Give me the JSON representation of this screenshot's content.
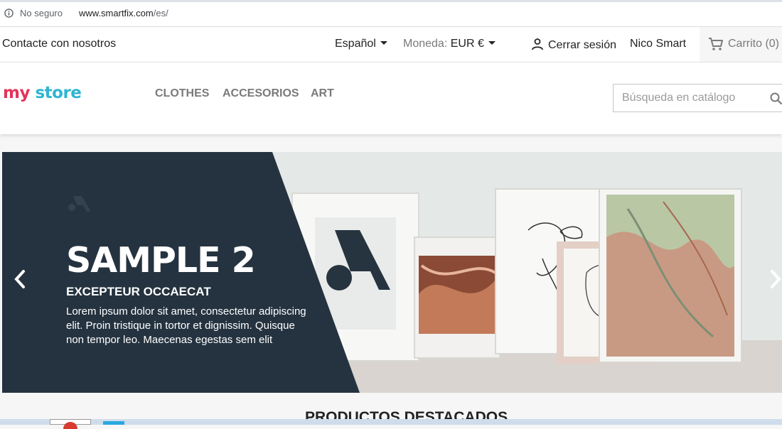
{
  "browser": {
    "security_label": "No seguro",
    "url_host": "www.smartfix.com",
    "url_path": "/es/"
  },
  "topnav": {
    "contact": "Contacte con nosotros",
    "language": "Español",
    "currency_label": "Moneda:",
    "currency_value": "EUR €",
    "logout": "Cerrar sesión",
    "user": "Nico Smart",
    "cart": "Carrito (0)"
  },
  "header": {
    "logo": {
      "part1": "my",
      "part2": " store"
    },
    "menu": [
      "CLOTHES",
      "ACCESORIOS",
      "ART"
    ],
    "search_placeholder": "Búsqueda en catálogo"
  },
  "slide": {
    "title": "SAMPLE 2",
    "subtitle": "EXCEPTEUR OCCAECAT",
    "text": "Lorem ipsum dolor sit amet, consectetur adipiscing elit. Proin tristique in tortor et dignissim. Quisque non tempor leo. Maecenas egestas sem elit",
    "panel_color": "#253340"
  },
  "featured_title": "PRODUCTOS DESTACADOS",
  "icons": {
    "info": "info-icon",
    "person": "person-icon",
    "cart": "cart-icon",
    "search": "search-icon",
    "prev": "chevron-left-icon",
    "next": "chevron-right-icon"
  }
}
